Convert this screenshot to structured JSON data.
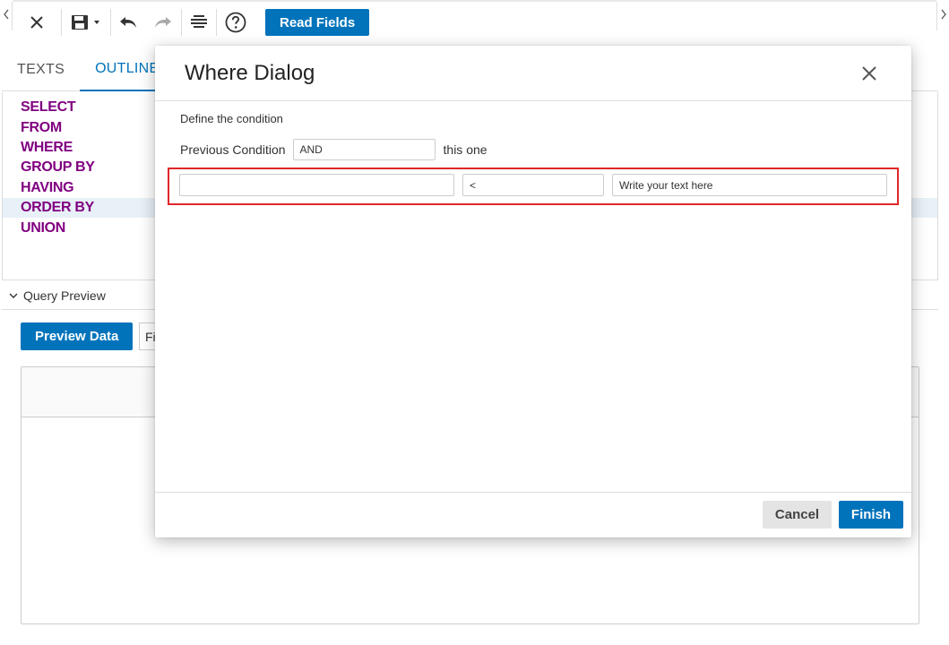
{
  "toolbar": {
    "read_fields_label": "Read Fields"
  },
  "tabs": [
    {
      "label": "TEXTS",
      "active": false
    },
    {
      "label": "OUTLINE",
      "active": true
    }
  ],
  "outline": {
    "items": [
      "SELECT",
      "FROM",
      "WHERE",
      "GROUP BY",
      "HAVING",
      "ORDER BY",
      "UNION"
    ],
    "selected": "ORDER BY"
  },
  "query_preview": {
    "header": "Query Preview",
    "preview_button": "Preview Data",
    "filter_partial": "Fi"
  },
  "dialog": {
    "title": "Where Dialog",
    "define_label": "Define the condition",
    "previous_condition_label": "Previous Condition",
    "previous_condition_value": "AND",
    "this_one_label": "this one",
    "condition": {
      "left_value": "",
      "operator": "<",
      "right_value": "Write your text here"
    },
    "cancel_label": "Cancel",
    "finish_label": "Finish"
  },
  "colors": {
    "accent": "#0073bb",
    "keyword": "#800080",
    "highlight_border": "#e0262a"
  }
}
